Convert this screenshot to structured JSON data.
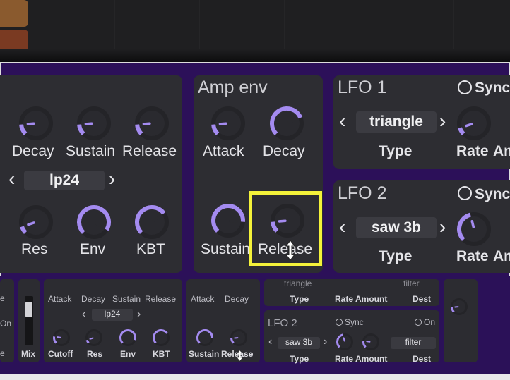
{
  "colors": {
    "accent": "#a48bf0",
    "panel": "#2d2d32",
    "background": "#2c1059",
    "highlight": "#f4f23a"
  },
  "zoom": {
    "filter": {
      "labels_row1": [
        "Decay",
        "Sustain",
        "Release"
      ],
      "filter_type": "lp24",
      "labels_row2": [
        "Res",
        "Env",
        "KBT"
      ],
      "knobs_row1": [
        0.15,
        0.15,
        0.15
      ],
      "knobs_row2": [
        0.1,
        0.95,
        0.7
      ]
    },
    "amp_env": {
      "title": "Amp env",
      "labels_row1": [
        "Attack",
        "Decay"
      ],
      "labels_row2": [
        "Sustain",
        "Release"
      ],
      "knobs_row1": [
        0.15,
        0.75
      ],
      "knobs_row2": [
        0.85,
        0.15
      ]
    },
    "lfo1": {
      "title": "LFO 1",
      "sync_label": "Sync",
      "waveform": "triangle",
      "type_label": "Type",
      "rate_label": "Rate",
      "amount_label": "Am",
      "rate_knob": 0.1
    },
    "lfo2": {
      "title": "LFO 2",
      "sync_label": "Sync",
      "waveform": "saw 3b",
      "type_label": "Type",
      "rate_label": "Rate",
      "amount_label": "Am",
      "rate_knob": 0.45
    }
  },
  "mini": {
    "top_labels": [
      "Attack",
      "Decay",
      "Sustain",
      "Release",
      "Attack",
      "Decay",
      "Type",
      "Rate",
      "Amount",
      "Dest"
    ],
    "top_partial": [
      "triangle",
      "filter"
    ],
    "side_labels": [
      "e",
      "On",
      "e"
    ],
    "mix_label": "Mix",
    "filter_type": "lp24",
    "filter_labels": [
      "Cutoff",
      "Res",
      "Env",
      "KBT"
    ],
    "amp_labels": [
      "Sustain",
      "Release"
    ],
    "lfo2": {
      "title": "LFO 2",
      "sync_label": "Sync",
      "on_label": "On",
      "waveform": "saw 3b",
      "dest": "filter",
      "type_label": "Type",
      "rate_label": "Rate",
      "amount_label": "Amount",
      "dest_label": "Dest"
    }
  },
  "icons": {
    "left_arrow": "‹",
    "right_arrow": "›"
  }
}
